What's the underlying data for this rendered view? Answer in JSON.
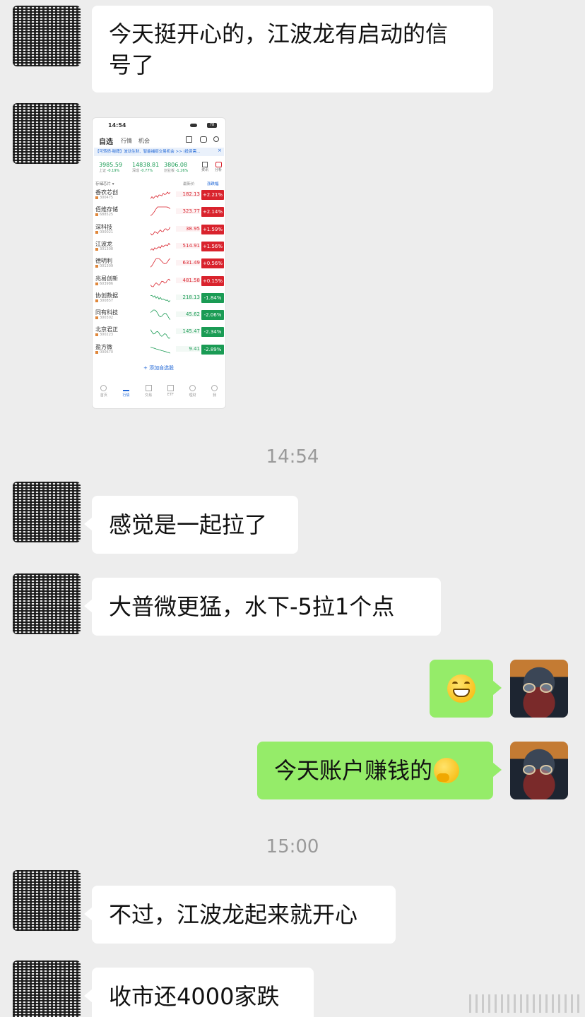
{
  "messages": {
    "m1": {
      "line1": "今天挺开心的，江波龙有启动的信",
      "line2": "号了"
    },
    "m2": "感觉是一起拉了",
    "m3": "大普微更猛，水下-5拉1个点",
    "m4_emoji": "grinning-face",
    "m5": "今天账户赚钱的",
    "m5_emoji": "thinking-face",
    "m6": "不过，江波龙起来就开心",
    "m7": "收市还4000家跌"
  },
  "timestamps": [
    "14:54",
    "15:00"
  ],
  "screenshot": {
    "status_time": "14:54",
    "battery": "78",
    "tabs": [
      "自选",
      "行情",
      "机会"
    ],
    "banner": "【可转债·秘籍】波动生财、智能捕捉交易机会 >> (投资需...",
    "indices": [
      {
        "value": "3985.59",
        "name": "上证",
        "chg": "-0.19%"
      },
      {
        "value": "14838.81",
        "name": "深成",
        "chg": "-0.77%"
      },
      {
        "value": "3806.08",
        "name": "创业板",
        "chg": "-1.26%"
      }
    ],
    "index_icons": [
      "资讯",
      "分析"
    ],
    "list_header": {
      "group": "存储芯片",
      "sort1": "最新价",
      "sort2": "涨跌幅"
    },
    "stocks": [
      {
        "name": "香农芯创",
        "code": "300475",
        "price": "182.13",
        "pct": "+2.21%",
        "up": true
      },
      {
        "name": "佰维存储",
        "code": "688525",
        "price": "323.77",
        "pct": "+2.14%",
        "up": true
      },
      {
        "name": "深科技",
        "code": "000021",
        "price": "38.95",
        "pct": "+1.59%",
        "up": true
      },
      {
        "name": "江波龙",
        "code": "301308",
        "price": "514.91",
        "pct": "+1.56%",
        "up": true
      },
      {
        "name": "德明利",
        "code": "001309",
        "price": "631.49",
        "pct": "+0.56%",
        "up": true
      },
      {
        "name": "兆易创新",
        "code": "603986",
        "price": "481.58",
        "pct": "+0.15%",
        "up": true
      },
      {
        "name": "协创数据",
        "code": "300857",
        "price": "218.13",
        "pct": "-1.84%",
        "up": false
      },
      {
        "name": "同有科技",
        "code": "300302",
        "price": "45.62",
        "pct": "-2.06%",
        "up": false
      },
      {
        "name": "北京君正",
        "code": "300223",
        "price": "145.47",
        "pct": "-2.34%",
        "up": false
      },
      {
        "name": "盈方微",
        "code": "000670",
        "price": "9.41",
        "pct": "-2.89%",
        "up": false
      }
    ],
    "add_label": "+ 添加自选股",
    "bottom_nav": [
      "首页",
      "行情",
      "交易",
      "ETF",
      "理财",
      "我"
    ],
    "colors": {
      "up": "#d9232d",
      "down": "#1a9b54",
      "accent": "#1f66d6"
    }
  },
  "colors": {
    "background": "#ededed",
    "bubble_left": "#ffffff",
    "bubble_right": "#95ec69"
  }
}
